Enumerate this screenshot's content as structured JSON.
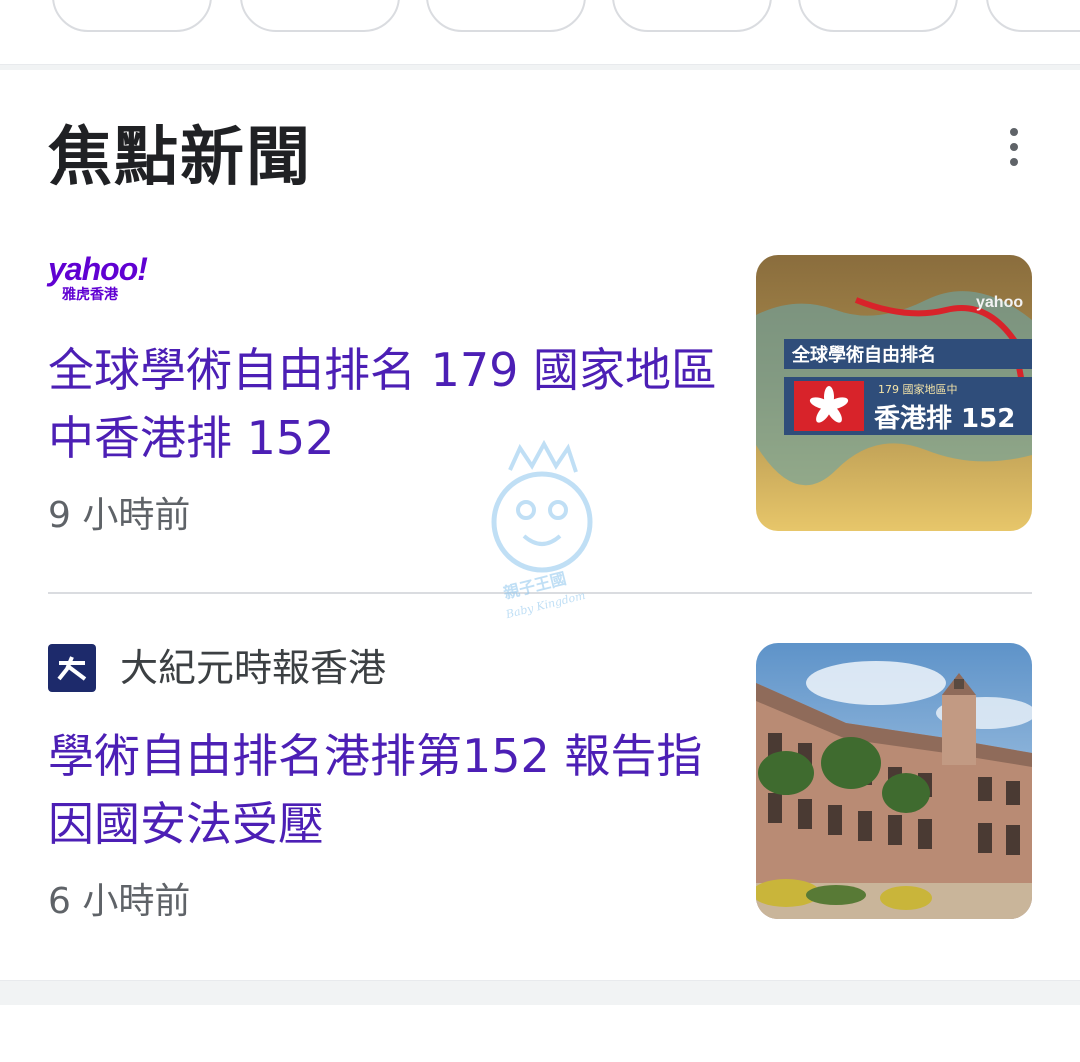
{
  "section": {
    "title": "焦點新聞"
  },
  "articles": [
    {
      "source": "Yahoo",
      "source_logo_text": "yahoo!",
      "source_logo_sub": "雅虎香港",
      "headline": "全球學術自由排名 179 國家地區中香港排 152",
      "time": "9 小時前",
      "thumb_text": {
        "line1": "全球學術自由排名",
        "line2": "179 國家地區中",
        "line3": "香港排 152",
        "brand": "yahoo"
      }
    },
    {
      "source": "大紀元時報香港",
      "headline": "學術自由排名港排第152 報告指因國安法受壓",
      "time": "6 小時前"
    }
  ],
  "watermark": {
    "line1": "親子王國",
    "line2": "Baby Kingdom"
  },
  "colors": {
    "headline": "#4c1fb5",
    "yahoo_purple": "#6001d2",
    "epoch_navy": "#1d2a6b"
  },
  "icons": {
    "menu": "more-vert-icon"
  }
}
